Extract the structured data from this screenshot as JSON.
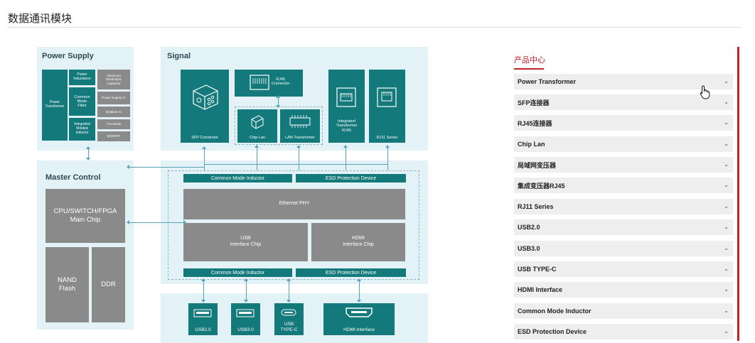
{
  "page": {
    "title": "数据通讯模块"
  },
  "diagram": {
    "power_supply": {
      "title": "Power Supply",
      "transformer": "Power\nTransformer",
      "power_inductance": "Power\nInductance",
      "aluminum_cap": "Aluminum\nElectrolytic\nCapacitor",
      "common_mode_filter": "Common\nMode\nFilter",
      "power_supply_ic": "Power Supply IC",
      "isolation_ic": "Isolation IC",
      "integrated_inductor": "Integrated\nMolded\nInductor",
      "tvs_diode": "Tvs Diode",
      "mosfet": "MOSFET"
    },
    "signal": {
      "title": "Signal",
      "sfp_connector": "SFP Connector",
      "rj45_connector": "RJ45\nConnector",
      "chip_lan": "Chip Lan",
      "lan_transformer": "LAN Transformer",
      "integrated_rj45": "Integrated\nTransformer\nRJ45",
      "rj11": "RJ11 Series"
    },
    "master_control": {
      "title": "Master Control",
      "main_chip": "CPU/SWITCH/FPGA\nMain Chip",
      "nand": "NAND\nFlash",
      "ddr": "DDR"
    },
    "center": {
      "cmi_top": "Common Mode Inductor",
      "esd_top": "ESD Protection Device",
      "phy": "Ethernet PHY",
      "usb_chip": "USB\nInterface Chip",
      "hdmi_chip": "HDMI\nInterface Chip",
      "cmi_bottom": "Common Mode Inductor",
      "esd_bottom": "ESD Protection Device"
    },
    "ports": {
      "usb20": "USB2.0",
      "usb30": "USB3.0",
      "usbc": "USB\nTYPE-C",
      "hdmi": "HDMI Interface"
    }
  },
  "sidebar": {
    "tab": "产品中心",
    "items": [
      {
        "label": "Power Transformer"
      },
      {
        "label": "SFP连接器"
      },
      {
        "label": "RJ45连接器"
      },
      {
        "label": "Chip Lan"
      },
      {
        "label": "局域网变压器"
      },
      {
        "label": "集成变压器RJ45"
      },
      {
        "label": "RJ11 Series"
      },
      {
        "label": "USB2.0"
      },
      {
        "label": "USB3.0"
      },
      {
        "label": "USB TYPE-C"
      },
      {
        "label": "HDMI Interface"
      },
      {
        "label": "Common Mode Inductor"
      },
      {
        "label": "ESD Protection Device"
      }
    ],
    "chevron": "⌄",
    "accent": "#c61f2a"
  },
  "colors": {
    "teal": "#14797a",
    "panel": "#e3f2f6",
    "grey": "#8a8a8a"
  }
}
